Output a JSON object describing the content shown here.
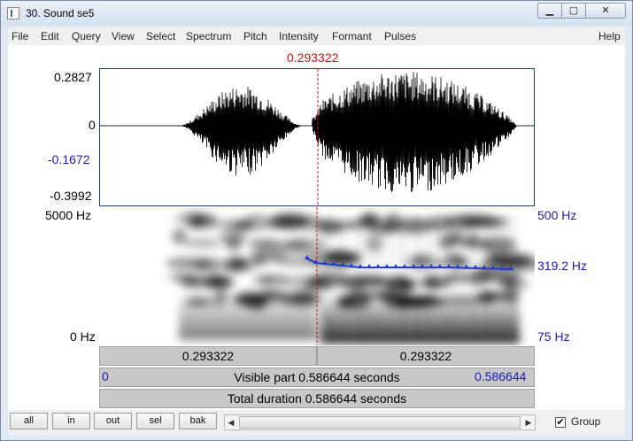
{
  "window": {
    "title": "30. Sound se5"
  },
  "menu": [
    "File",
    "Edit",
    "Query",
    "View",
    "Select",
    "Spectrum",
    "Pitch",
    "Intensity",
    "Formant",
    "Pulses",
    "Help"
  ],
  "cursor_time": "0.293322",
  "waveform_axis": {
    "top": "0.2827",
    "zero": "0",
    "cursor_value": "-0.1672",
    "bottom": "-0.3992"
  },
  "spectrogram_axis": {
    "top": "5000 Hz",
    "bottom": "0 Hz"
  },
  "pitch_axis": {
    "top": "500 Hz",
    "value": "319.2 Hz",
    "bottom": "75 Hz"
  },
  "selection": {
    "left": "0.293322",
    "right": "0.293322"
  },
  "visible": {
    "start": "0",
    "label": "Visible part 0.586644 seconds",
    "end": "0.586644"
  },
  "total": {
    "label": "Total duration 0.586644 seconds"
  },
  "buttons": {
    "all": "all",
    "in": "in",
    "out": "out",
    "sel": "sel",
    "bak": "bak"
  },
  "group": {
    "label": "Group",
    "checked": true
  },
  "colors": {
    "cursor": "#c81414",
    "pitch": "#1f3fd0",
    "axis_blue": "#1a1ab4"
  }
}
